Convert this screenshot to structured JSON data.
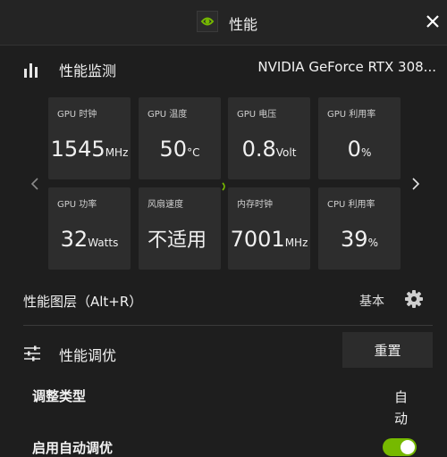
{
  "titlebar": {
    "title": "性能"
  },
  "monitor": {
    "title": "性能监测",
    "gpu_name": "NVIDIA GeForce RTX 308...",
    "tiles": [
      {
        "label": "GPU 时钟",
        "value": "1545",
        "unit": "MHz"
      },
      {
        "label": "GPU 温度",
        "value": "50",
        "unit": "°C"
      },
      {
        "label": "GPU 电压",
        "value": "0.8",
        "unit": "Volt"
      },
      {
        "label": "GPU 利用率",
        "value": "0",
        "unit": "%"
      },
      {
        "label": "GPU 功率",
        "value": "32",
        "unit": "Watts"
      },
      {
        "label": "风扇速度",
        "value": "不适用",
        "unit": ""
      },
      {
        "label": "内存时钟",
        "value": "7001",
        "unit": "MHz"
      },
      {
        "label": "CPU 利用率",
        "value": "39",
        "unit": "%"
      }
    ]
  },
  "overlay": {
    "label": "性能图层（Alt+R）",
    "mode": "基本"
  },
  "tuning": {
    "title": "性能调优",
    "reset_label": "重置",
    "type_label": "调整类型",
    "type_value": "自动",
    "cutoff_label": "启用自动调优"
  },
  "colors": {
    "accent": "#76b900",
    "background": "#1e1e1e",
    "tile": "#2d2d2d"
  }
}
